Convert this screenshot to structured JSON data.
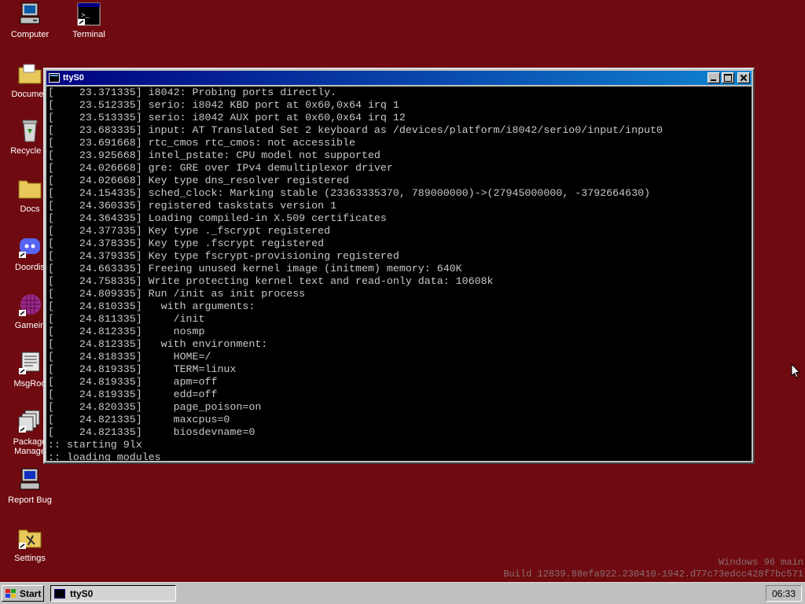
{
  "desktop": {
    "icons": [
      {
        "label": "Computer",
        "icon": "computer-icon"
      },
      {
        "label": "Terminal",
        "icon": "terminal-icon"
      },
      {
        "label": "Documen",
        "icon": "folder-icon"
      },
      {
        "label": "Recycle B",
        "icon": "recycle-bin-icon"
      },
      {
        "label": "Docs",
        "icon": "folder-icon"
      },
      {
        "label": "Doordis",
        "icon": "discord-icon"
      },
      {
        "label": "Gamein",
        "icon": "game-icon"
      },
      {
        "label": "MsgRoo",
        "icon": "msgroom-icon"
      },
      {
        "label": "Package\nManage",
        "icon": "package-manager-icon"
      },
      {
        "label": "Report Bug",
        "icon": "report-bug-icon"
      },
      {
        "label": "Settings",
        "icon": "settings-icon"
      }
    ]
  },
  "window": {
    "title": "ttyS0",
    "terminal_lines": [
      "[    23.371335] i8042: Probing ports directly.",
      "[    23.512335] serio: i8042 KBD port at 0x60,0x64 irq 1",
      "[    23.513335] serio: i8042 AUX port at 0x60,0x64 irq 12",
      "[    23.683335] input: AT Translated Set 2 keyboard as /devices/platform/i8042/serio0/input/input0",
      "[    23.691668] rtc_cmos rtc_cmos: not accessible",
      "[    23.925668] intel_pstate: CPU model not supported",
      "[    24.026668] gre: GRE over IPv4 demultiplexor driver",
      "[    24.026668] Key type dns_resolver registered",
      "[    24.154335] sched_clock: Marking stable (23363335370, 789000000)->(27945000000, -3792664630)",
      "[    24.360335] registered taskstats version 1",
      "[    24.364335] Loading compiled-in X.509 certificates",
      "[    24.377335] Key type ._fscrypt registered",
      "[    24.378335] Key type .fscrypt registered",
      "[    24.379335] Key type fscrypt-provisioning registered",
      "[    24.663335] Freeing unused kernel image (initmem) memory: 640K",
      "[    24.758335] Write protecting kernel text and read-only data: 10608k",
      "[    24.809335] Run /init as init process",
      "[    24.810335]   with arguments:",
      "[    24.811335]     /init",
      "[    24.812335]     nosmp",
      "[    24.812335]   with environment:",
      "[    24.818335]     HOME=/",
      "[    24.819335]     TERM=linux",
      "[    24.819335]     apm=off",
      "[    24.819335]     edd=off",
      "[    24.820335]     page_poison=on",
      "[    24.821335]     maxcpus=0",
      "[    24.821335]     biosdevname=0",
      ":: starting 9lx",
      ":: loading modules"
    ]
  },
  "watermark": {
    "line1": "Windows 96 main",
    "line2": "Build 12839.88efa922.230410-1942.d77c73edcc428f7bc571"
  },
  "taskbar": {
    "start_label": "Start",
    "task_label": "ttyS0",
    "clock": "06:33"
  },
  "colors": {
    "desktop": "#6f0b10",
    "titlebar_start": "#000080",
    "titlebar_end": "#1084d0",
    "terminal_bg": "#000000",
    "terminal_fg": "#c8c8c8"
  }
}
